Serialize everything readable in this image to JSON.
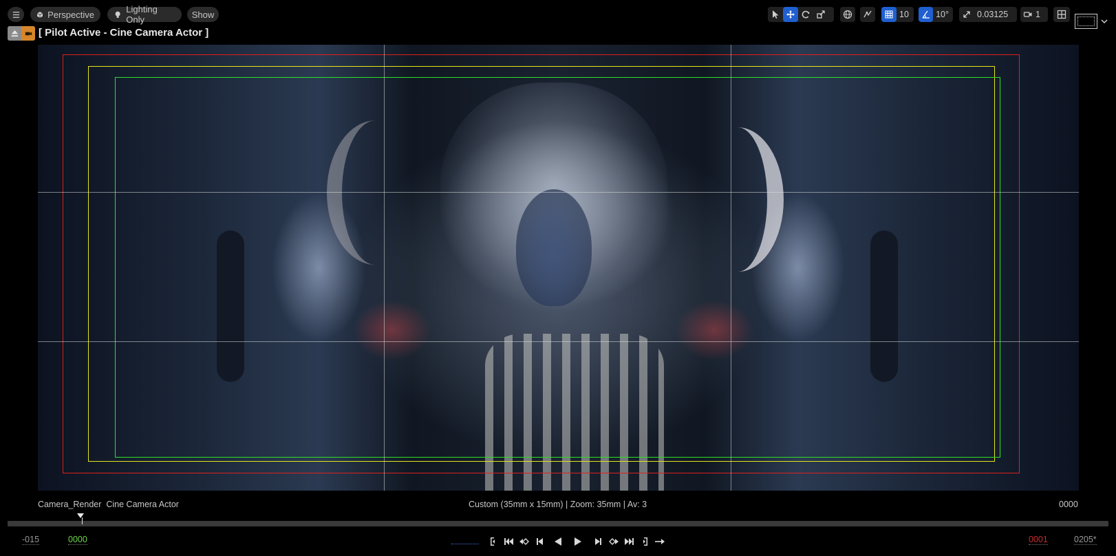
{
  "toolbar_left": {
    "menu_icon": "hamburger-icon",
    "viewport_type": "Perspective",
    "view_mode": "Lighting Only",
    "show": "Show"
  },
  "toolbar_right": {
    "grid_snap": "10",
    "rotation_snap": "10°",
    "scale_snap": "0.03125",
    "camera_speed": "1"
  },
  "pilot": {
    "label": "[ Pilot Active - Cine Camera Actor ]"
  },
  "viewport": {
    "camera_name": "Camera_Render",
    "camera_type": "Cine Camera Actor",
    "camera_info": "Custom (35mm x 15mm) | Zoom: 35mm | Av: 3",
    "frame_readout": "0000"
  },
  "timeline": {
    "start": "-015",
    "current": "0000",
    "selection_end": "0001",
    "end": "0205*"
  },
  "colors": {
    "accent": "#1f5fd0",
    "safe_frame_outer": "#e0201e",
    "safe_frame_title": "#e6e61a",
    "safe_frame_action": "#2ee02a",
    "timeline_current": "#6fd44a",
    "timeline_end_mark": "#cc2a2a"
  }
}
